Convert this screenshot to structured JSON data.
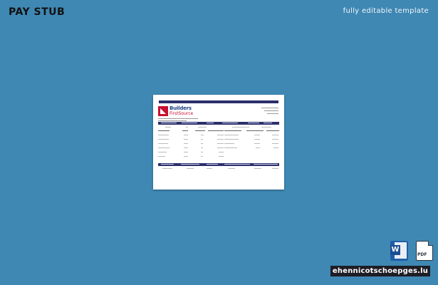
{
  "header": {
    "title": "PAY STUB",
    "subtitle": "fully editable template"
  },
  "document": {
    "logo_line1": "Builders",
    "logo_line2": "FirstSource"
  },
  "badges": {
    "word_letter": "W",
    "pdf_label": "PDF"
  },
  "footer": {
    "site": "ehennicotschoepges.lu"
  },
  "colors": {
    "background": "#3f88b4",
    "header_bar": "#2b2f6b",
    "brand_red": "#c8102e"
  }
}
